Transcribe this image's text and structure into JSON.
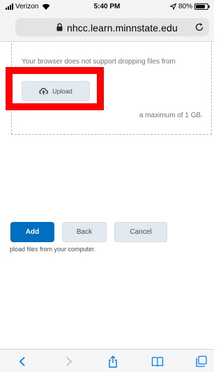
{
  "status_bar": {
    "carrier": "Verizon",
    "time": "5:40 PM",
    "battery_label": "80%",
    "battery_level": 0.8
  },
  "browser": {
    "url": "nhcc.learn.minnstate.edu"
  },
  "dropzone": {
    "message": "Your browser does not support dropping files from",
    "limit_fragment": "a maximum of 1 GB.",
    "upload_label": "Upload"
  },
  "actions": {
    "add_label": "Add",
    "back_label": "Back",
    "cancel_label": "Cancel",
    "hint": "pload files from your computer."
  },
  "colors": {
    "primary": "#006fbf",
    "annotation": "#ff0000",
    "ios_blue": "#007aff"
  },
  "toolbar": {
    "icons": [
      "back-icon",
      "forward-icon",
      "share-icon",
      "bookmarks-icon",
      "tabs-icon"
    ]
  }
}
